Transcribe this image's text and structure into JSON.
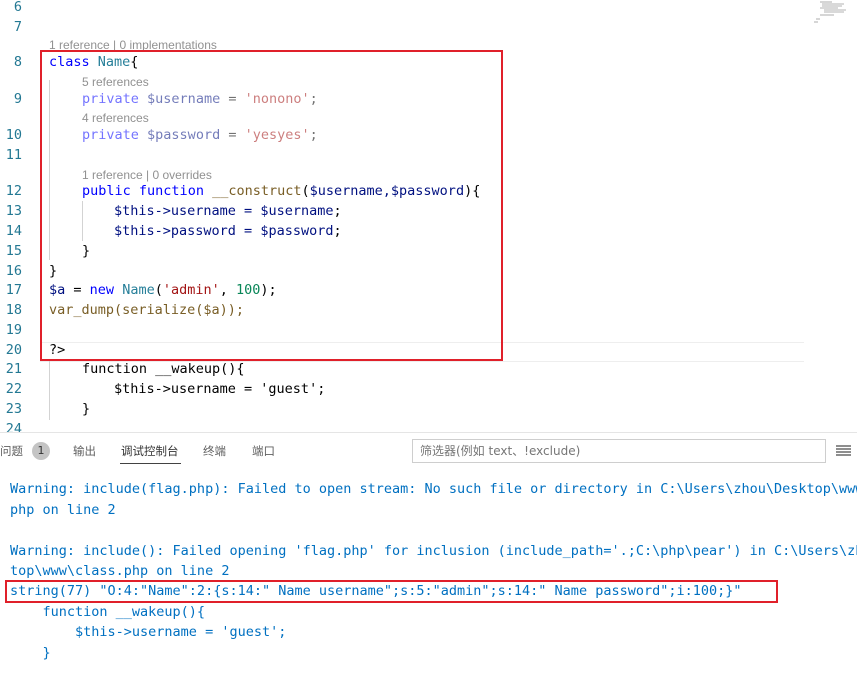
{
  "editor": {
    "line_numbers": [
      "6",
      "7",
      "8",
      "9",
      "10",
      "11",
      "12",
      "13",
      "14",
      "15",
      "16",
      "17",
      "18",
      "19",
      "20",
      "21",
      "22",
      "23",
      "24"
    ],
    "codelens": {
      "class_refs": "1 reference | 0 implementations",
      "username_refs": "5 references",
      "password_refs": "4 references",
      "construct_refs": "1 reference | 0 overrides"
    },
    "tokens": {
      "class_kw": "class",
      "class_name": "Name",
      "brace_open": "{",
      "private_kw": "private",
      "username_var": "$username",
      "eq": " = ",
      "username_val": "'nonono'",
      "semi": ";",
      "password_var": "$password",
      "password_val": "'yesyes'",
      "public_kw": "public",
      "function_kw": "function",
      "construct_name": "__construct",
      "paren_open": "(",
      "params": "$username,$password",
      "paren_close": ")",
      "this_username": "$this->username = ",
      "this_password": "$this->password = ",
      "arg_username": "$username",
      "arg_password": "$password",
      "close_brace": "}",
      "a_var": "$a",
      "new_kw": "new",
      "new_class": "Name",
      "arg_admin": "'admin'",
      "comma": ", ",
      "arg_100": "100",
      "close_call": ");",
      "var_dump_line": "var_dump(serialize($a));",
      "php_close": "?>",
      "wakeup_line": "function __wakeup(){",
      "wakeup_body": "$this->username = 'guest';",
      "wakeup_close": "}"
    }
  },
  "panel": {
    "tabs": [
      "问题",
      "输出",
      "调试控制台",
      "终端",
      "端口"
    ],
    "problems_count": "1",
    "filter_placeholder": "筛选器(例如 text、!exclude)",
    "output_lines": [
      "Warning: include(flag.php): Failed to open stream: No such file or directory in C:\\Users\\zhou\\Desktop\\www\\",
      "php on line 2",
      "",
      "Warning: include(): Failed opening 'flag.php' for inclusion (include_path='.;C:\\php\\pear') in C:\\Users\\zhc",
      "top\\www\\class.php on line 2",
      "string(77) \"O:4:\"Name\":2:{s:14:\" Name username\";s:5:\"admin\";s:14:\" Name password\";i:100;}\"",
      "    function __wakeup(){",
      "        $this->username = 'guest';",
      "    }"
    ]
  },
  "colors": {
    "keyword": "#0000ff",
    "class_name": "#267f99",
    "variable": "#001080",
    "string": "#a31515",
    "number": "#098658",
    "line_number": "#237893",
    "output_text": "#0070c1",
    "highlight_box": "#e0202a"
  }
}
